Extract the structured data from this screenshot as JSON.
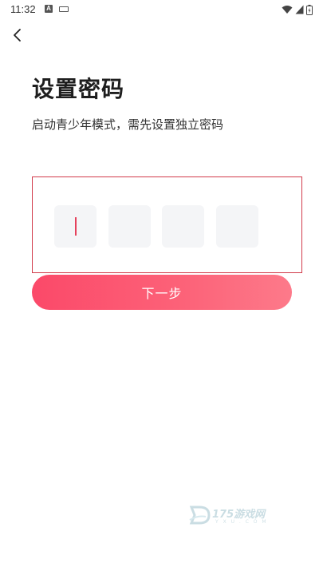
{
  "status_bar": {
    "time": "11:32",
    "notification_icon_letter": "A",
    "icons": [
      "a-notification-icon",
      "keyboard-icon",
      "wifi-icon",
      "signal-icon",
      "battery-icon"
    ]
  },
  "header": {
    "back_icon": "chevron-left-icon"
  },
  "main": {
    "title": "设置密码",
    "subtitle": "启动青少年模式，需先设置独立密码",
    "pin": {
      "length": 4,
      "value": "",
      "focused_index": 0
    },
    "next_button_label": "下一步"
  },
  "watermark": {
    "text": "175游戏网",
    "sub": "Y X U . C O M"
  },
  "colors": {
    "accent": "#fb4969",
    "accent_end": "#fd7a8a",
    "pin_border": "#d13a4a",
    "cell_bg": "#f4f5f7",
    "caret": "#e5415c"
  }
}
